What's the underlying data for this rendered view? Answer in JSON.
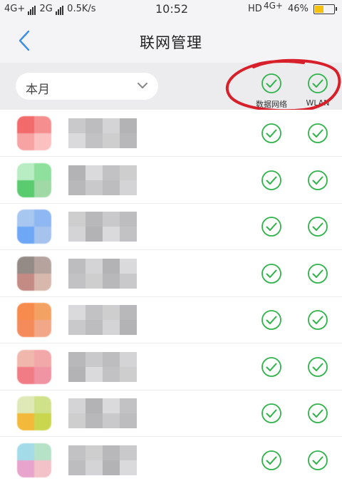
{
  "status_bar": {
    "network_left": "4G+",
    "network_sim2": "2G",
    "speed": "0.5K/s",
    "time": "10:52",
    "hd": "HD",
    "network_right": "4G+",
    "battery": "46%",
    "battery_level": 0.46,
    "battery_color": "#f4c20d"
  },
  "nav": {
    "title": "联网管理",
    "back_icon": "chevron-left-icon",
    "accent": "#3a8ee6"
  },
  "filter": {
    "period": "本月",
    "columns": [
      "数据网络",
      "WLAN"
    ],
    "check_color": "#2fb34a",
    "annotation_color": "#d8202a"
  },
  "apps": [
    {
      "name": "",
      "icon_colors": [
        "#f26a6a",
        "#f58f8f",
        "#f7a3a3",
        "#fbc0c0"
      ],
      "mobile_data": true,
      "wlan": true
    },
    {
      "name": "",
      "icon_colors": [
        "#b8ecc3",
        "#8fe09c",
        "#5acb6e",
        "#9ed9a6"
      ],
      "mobile_data": true,
      "wlan": true
    },
    {
      "name": "",
      "icon_colors": [
        "#a7c6f0",
        "#8fb8f2",
        "#6ea7f5",
        "#a6c3ee"
      ],
      "mobile_data": true,
      "wlan": true
    },
    {
      "name": "",
      "icon_colors": [
        "#948a86",
        "#b6a39e",
        "#c48a84",
        "#d8b8ac"
      ],
      "mobile_data": true,
      "wlan": true
    },
    {
      "name": "",
      "icon_colors": [
        "#f78b4e",
        "#f4a264",
        "#f58a5a",
        "#f2a888"
      ],
      "mobile_data": true,
      "wlan": true
    },
    {
      "name": "",
      "icon_colors": [
        "#f0b7ad",
        "#f2a8a8",
        "#f27c86",
        "#f093a3"
      ],
      "mobile_data": true,
      "wlan": true
    },
    {
      "name": "",
      "icon_colors": [
        "#dfe9b8",
        "#cfe28a",
        "#f2b93a",
        "#c9d64e"
      ],
      "mobile_data": true,
      "wlan": true
    },
    {
      "name": "",
      "icon_colors": [
        "#a3dbe8",
        "#b6e2c8",
        "#e8a4cc",
        "#f3c2c8"
      ],
      "mobile_data": true,
      "wlan": true
    }
  ]
}
